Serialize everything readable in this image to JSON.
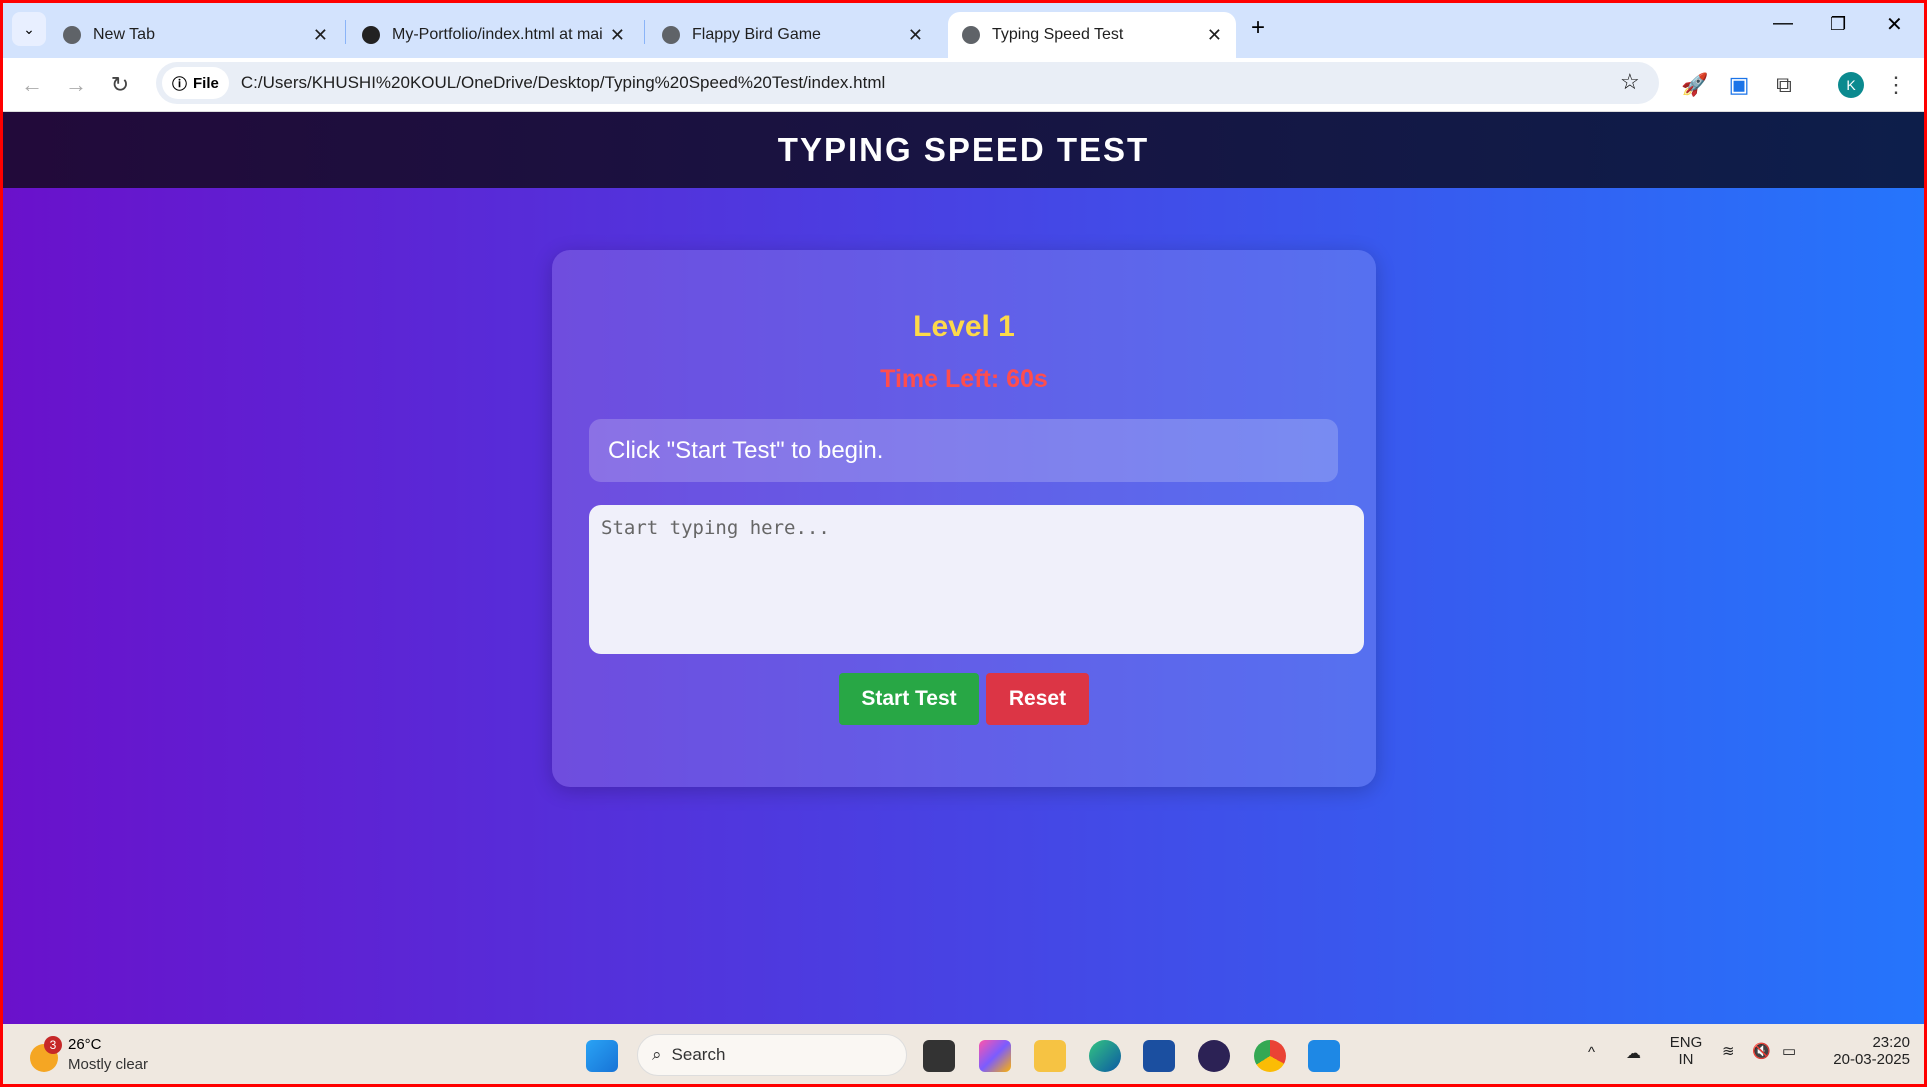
{
  "browser": {
    "tabs": [
      {
        "label": "New Tab",
        "icon": "globe-icon"
      },
      {
        "label": "My-Portfolio/index.html at main",
        "icon": "github-icon"
      },
      {
        "label": "Flappy Bird Game",
        "icon": "globe-icon"
      },
      {
        "label": "Typing Speed Test",
        "icon": "globe-icon",
        "active": true
      }
    ],
    "new_tab": "+",
    "chip": "File",
    "url": "C:/Users/KHUSHI%20KOUL/OneDrive/Desktop/Typing%20Speed%20Test/index.html",
    "profile": "K"
  },
  "page": {
    "header": "TYPING SPEED TEST",
    "level": "Level 1",
    "timer": "Time Left: 60s",
    "sentence": "Click \"Start Test\" to begin.",
    "input_placeholder": "Start typing here...",
    "start_label": "Start Test",
    "reset_label": "Reset",
    "colors": {
      "gradient_start": "#6a11cb",
      "gradient_end": "#2575fc",
      "level": "#fdd94a",
      "timer": "#ff4d4d",
      "start": "#28a745",
      "reset": "#dc3545"
    }
  },
  "taskbar": {
    "weather_badge": "3",
    "temp": "26°C",
    "weather": "Mostly clear",
    "search": "Search",
    "lang1": "ENG",
    "lang2": "IN",
    "time": "23:20",
    "date": "20-03-2025"
  }
}
